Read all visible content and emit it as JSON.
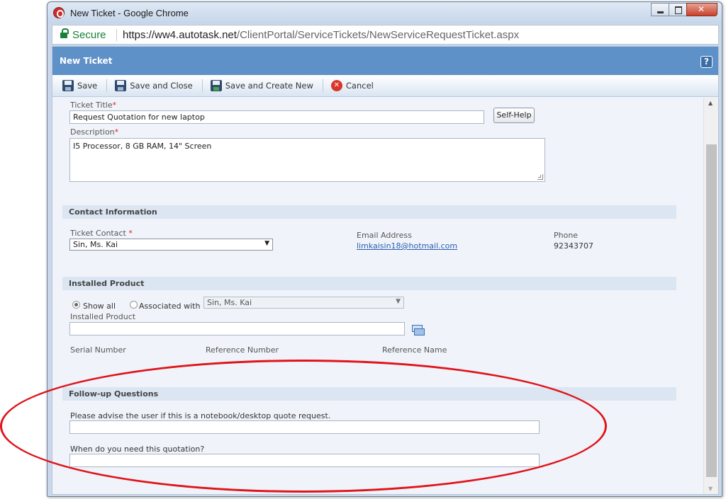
{
  "window": {
    "title": "New Ticket - Google Chrome",
    "secure_label": "Secure",
    "url_host": "https://ww4.autotask.net",
    "url_path": "/ClientPortal/ServiceTickets/NewServiceRequestTicket.aspx"
  },
  "page": {
    "title": "New Ticket",
    "help_label": "?"
  },
  "toolbar": {
    "save": "Save",
    "save_close": "Save and Close",
    "save_new": "Save and Create New",
    "cancel": "Cancel"
  },
  "ticket": {
    "title_label": "Ticket Title",
    "title_value": "Request Quotation for new laptop",
    "self_help": "Self-Help",
    "description_label": "Description",
    "description_value": "I5 Processor, 8 GB RAM, 14\" Screen",
    "required_mark": "*"
  },
  "contact": {
    "section_title": "Contact Information",
    "contact_label": "Ticket Contact",
    "contact_value": "Sin, Ms. Kai",
    "email_label": "Email Address",
    "email_value": "limkaisin18@hotmail.com",
    "phone_label": "Phone",
    "phone_value": "92343707"
  },
  "installed": {
    "section_title": "Installed Product",
    "show_all": "Show all",
    "associated_with": "Associated with",
    "associated_value": "Sin, Ms. Kai",
    "product_label": "Installed Product",
    "serial_label": "Serial Number",
    "reference_number_label": "Reference Number",
    "reference_name_label": "Reference Name"
  },
  "followup": {
    "section_title": "Follow-up Questions",
    "q1": "Please advise the user if this is a notebook/desktop quote request.",
    "q2": "When do you need this quotation?"
  },
  "colors": {
    "header_blue": "#5e91c8",
    "annotation_red": "#e0141b",
    "link_blue": "#2a5db0"
  }
}
